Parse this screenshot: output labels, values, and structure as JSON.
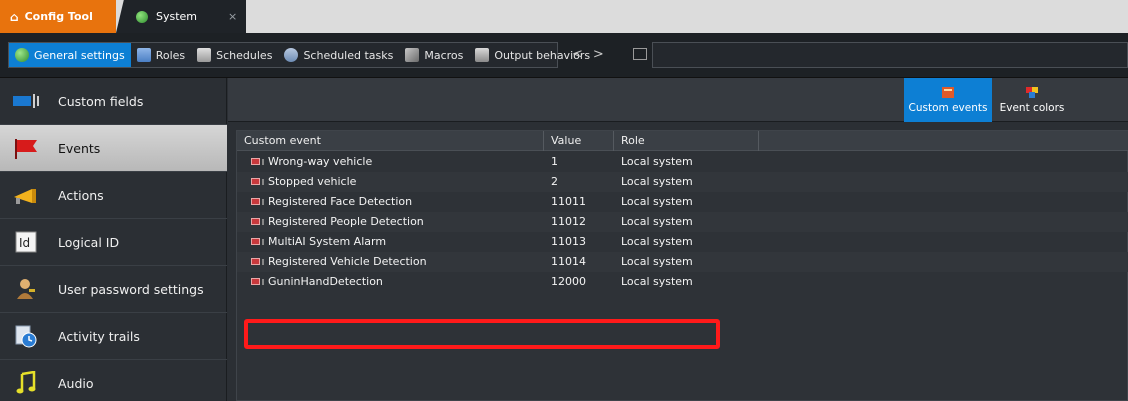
{
  "tabs": {
    "config_tool": "Config Tool",
    "system": "System",
    "close": "×"
  },
  "toolbar": {
    "items": [
      {
        "label": "General settings",
        "icon": "globe-icon",
        "active": true
      },
      {
        "label": "Roles",
        "icon": "server-icon"
      },
      {
        "label": "Schedules",
        "icon": "calendar-icon"
      },
      {
        "label": "Scheduled tasks",
        "icon": "gear-task-icon"
      },
      {
        "label": "Macros",
        "icon": "macro-icon"
      },
      {
        "label": "Output behaviors",
        "icon": "output-icon"
      }
    ],
    "back": "<",
    "forward": ">"
  },
  "sidebar": {
    "items": [
      {
        "label": "Custom fields",
        "icon": "custom-fields-icon"
      },
      {
        "label": "Events",
        "icon": "flag-icon",
        "selected": true
      },
      {
        "label": "Actions",
        "icon": "megaphone-icon"
      },
      {
        "label": "Logical ID",
        "icon": "id-icon"
      },
      {
        "label": "User password settings",
        "icon": "user-key-icon"
      },
      {
        "label": "Activity trails",
        "icon": "clock-icon"
      },
      {
        "label": "Audio",
        "icon": "music-note-icon"
      }
    ]
  },
  "header": {
    "custom_events": "Custom events",
    "event_colors": "Event colors"
  },
  "table": {
    "columns": [
      "Custom event",
      "Value",
      "Role"
    ],
    "rows": [
      {
        "event": "Wrong-way vehicle",
        "value": "1",
        "role": "Local system"
      },
      {
        "event": "Stopped vehicle",
        "value": "2",
        "role": "Local system"
      },
      {
        "event": "Registered Face Detection",
        "value": "11011",
        "role": "Local system"
      },
      {
        "event": "Registered People Detection",
        "value": "11012",
        "role": "Local system"
      },
      {
        "event": "MultiAI System Alarm",
        "value": "11013",
        "role": "Local system"
      },
      {
        "event": "Registered Vehicle Detection",
        "value": "11014",
        "role": "Local system"
      },
      {
        "event": "GuninHandDetection",
        "value": "12000",
        "role": "Local system"
      }
    ]
  },
  "colors": {
    "accent": "#0d7fd4",
    "config_tab": "#e8730d",
    "highlight": "#ff1a1a"
  }
}
